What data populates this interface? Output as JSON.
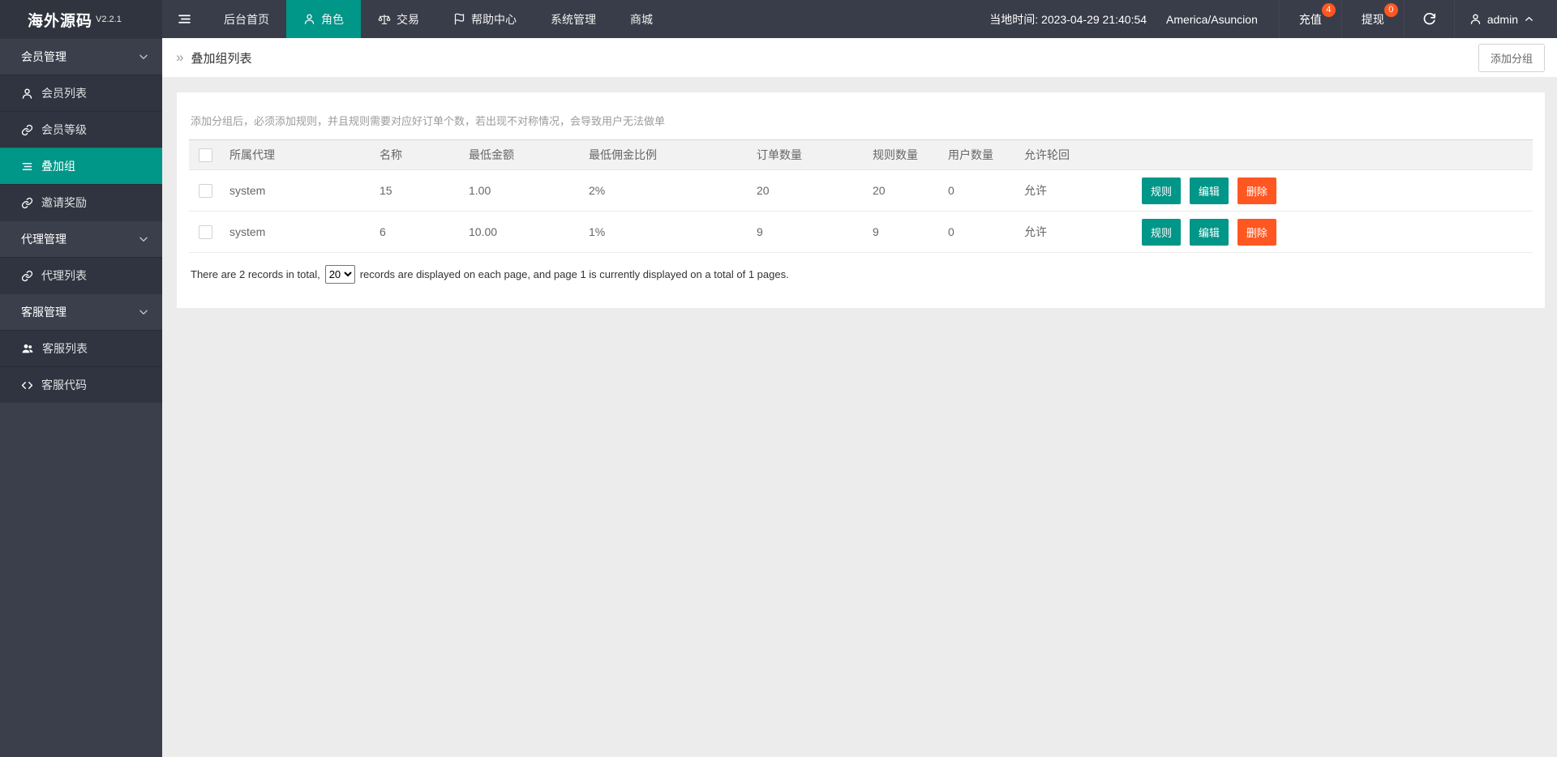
{
  "navbar": {
    "logo": "海外源码",
    "version": "V2.2.1",
    "items": [
      {
        "label": "后台首页"
      },
      {
        "label": "角色"
      },
      {
        "label": "交易"
      },
      {
        "label": "帮助中心"
      },
      {
        "label": "系统管理"
      },
      {
        "label": "商城"
      }
    ],
    "local_time": "当地时间: 2023-04-29 21:40:54",
    "timezone": "America/Asuncion",
    "recharge_label": "充值",
    "recharge_badge": "4",
    "withdraw_label": "提现",
    "withdraw_badge": "0",
    "username": "admin"
  },
  "sidebar": {
    "items": [
      {
        "label": "会员管理"
      },
      {
        "label": "会员列表"
      },
      {
        "label": "会员等级"
      },
      {
        "label": "叠加组"
      },
      {
        "label": "邀请奖励"
      },
      {
        "label": "代理管理"
      },
      {
        "label": "代理列表"
      },
      {
        "label": "客服管理"
      },
      {
        "label": "客服列表"
      },
      {
        "label": "客服代码"
      }
    ]
  },
  "page": {
    "breadcrumb_icon": "»",
    "breadcrumb": "叠加组列表",
    "add_group_button": "添加分组",
    "hint": "添加分组后，必须添加规则，并且规则需要对应好订单个数，若出现不对称情况，会导致用户无法做单"
  },
  "table": {
    "headers": [
      "所属代理",
      "名称",
      "最低金额",
      "最低佣金比例",
      "订单数量",
      "规则数量",
      "用户数量",
      "允许轮回"
    ],
    "rows": [
      {
        "agent": "system",
        "name": "15",
        "min_amount": "1.00",
        "min_commission": "2%",
        "orders": "20",
        "rules": "20",
        "users": "0",
        "recycle": "允许"
      },
      {
        "agent": "system",
        "name": "6",
        "min_amount": "10.00",
        "min_commission": "1%",
        "orders": "9",
        "rules": "9",
        "users": "0",
        "recycle": "允许"
      }
    ],
    "actions": {
      "rule": "规则",
      "edit": "编辑",
      "delete": "删除"
    }
  },
  "pagination": {
    "prefix": "There are 2 records in total,",
    "page_size": "20",
    "suffix": "records are displayed on each page, and page 1 is currently displayed on a total of 1 pages."
  },
  "colors": {
    "accent": "#009688",
    "danger": "#ff5722",
    "navbar": "#393d49"
  }
}
